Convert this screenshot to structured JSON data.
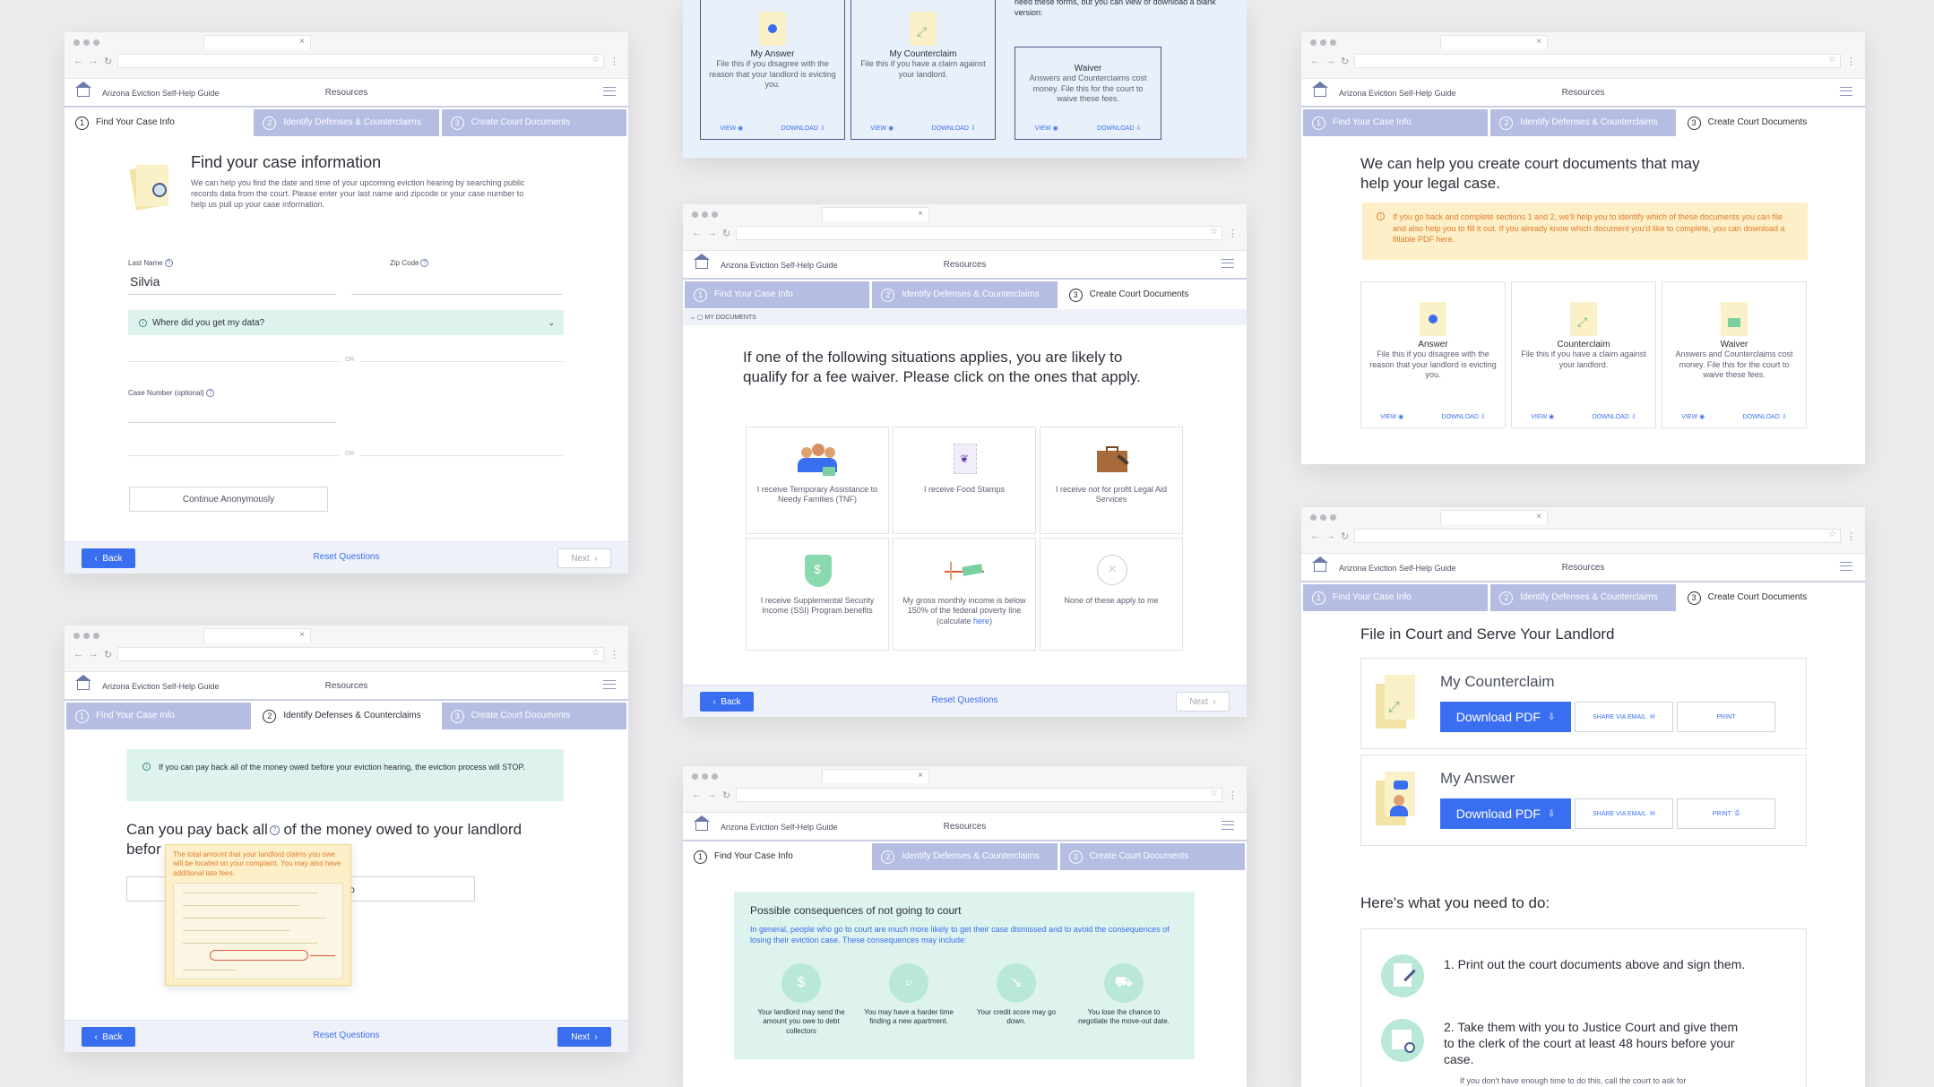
{
  "common": {
    "brand": "Arizona Eviction Self-Help Guide",
    "resources": "Resources",
    "step1": "Find Your Case Info",
    "step2": "Identify Defenses & Counterclaims",
    "step3": "Create Court Documents",
    "n1": "1",
    "n2": "2",
    "n3": "3",
    "back": "Back",
    "reset": "Reset Questions",
    "next": "Next",
    "view": "VIEW",
    "download": "DOWNLOAD"
  },
  "win1": {
    "title": "Find your case information",
    "desc": "We can help you find the date and time of your upcoming eviction hearing by searching public records data from the court. Please enter your last name and zipcode or your case number to help us pull up your case information.",
    "last_name_label": "Last Name",
    "last_name_value": "Silvia",
    "zip_label": "Zip Code",
    "data_q": "Where did you get my data?",
    "or": "OR",
    "case_label": "Case Number (optional)",
    "continue": "Continue Anonymously"
  },
  "win2": {
    "info": "If you can pay back all of the money owed before your eviction hearing, the eviction process will STOP.",
    "q_part1": "Can you pay back all",
    "q_part2": " of the money owed to your landlord",
    "q_part3": "befor",
    "tooltip": "The total amount that your landlord claims you owe will be located on your complaint. You may also have additional late fees.",
    "no": "No"
  },
  "win3": {
    "top_text": "need these forms, but you can view or download a blank version:",
    "cards": [
      {
        "title": "My Answer",
        "desc": "File this if you disagree with the reason that your landlord is evicting you."
      },
      {
        "title": "My Counterclaim",
        "desc": "File this if you have a claim against your landlord."
      },
      {
        "title": "Waiver",
        "desc": "Answers and Counterclaims cost money. File this for the court to waive these fees."
      }
    ]
  },
  "win4": {
    "mydocs": "MY DOCUMENTS",
    "title": "If one of the following situations applies, you are likely to qualify for a fee waiver. Please click on the ones that apply.",
    "options": [
      "I receive Temporary Assistance to Needy Families (TNF)",
      "I receive Food Stamps",
      "I receive not for profit Legal Aid Services",
      "I receive Supplemental Security Income (SSI) Program benefits",
      "My gross monthly income is below 150% of the federal poverty line",
      "None of these apply to me"
    ],
    "calc_pre": "(calculate ",
    "calc_link": "here",
    "calc_post": ")"
  },
  "win5": {
    "box_title": "Possible consequences of not going to court",
    "box_desc": "In general, people who go to court are much more likely to get their case dismissed and to avoid the consequences of losing their eviction case. These consequences may include:",
    "items": [
      "Your landlord may send the amount you owe to debt collectors",
      "You may have a harder time finding a new apartment.",
      "Your credit score may go down.",
      "You lose the chance to negotiate the move-out date."
    ]
  },
  "win6": {
    "title": "We can help you create court documents that may help your legal case.",
    "warning": "If you go back and complete sections 1 and 2, we'll help you to identify which of these documents you can file and also help you to fill it out. If you already know which document you'd like to complete, you can download a fillable PDF here.",
    "cards": [
      {
        "title": "Answer",
        "desc": "File this if you disagree with the reason that your landlord is evicting you."
      },
      {
        "title": "Counterclaim",
        "desc": "File this if you have a claim against your landlord."
      },
      {
        "title": "Waiver",
        "desc": "Answers and Counterclaims cost money. File this for the court to waive these fees."
      }
    ]
  },
  "win7": {
    "title": "File in Court and Serve Your Landlord",
    "docs": [
      {
        "title": "My Counterclaim"
      },
      {
        "title": "My Answer"
      }
    ],
    "download_pdf": "Download PDF",
    "share": "SHARE VIA EMAIL",
    "print": "PRINT",
    "todo": "Here's what you need to do:",
    "step1": "1.  Print out the court documents above and sign them.",
    "step2": "2.  Take them with you to Justice Court and give them to the clerk of the court at least 48 hours before your case.",
    "step_note": "If you don't have enough time to do this, call the court to ask for"
  },
  "colors": {
    "accent": "#3a6ef0",
    "step_inactive": "#b5bde3",
    "mint": "#def3ee",
    "warning": "#fdf0c8"
  }
}
